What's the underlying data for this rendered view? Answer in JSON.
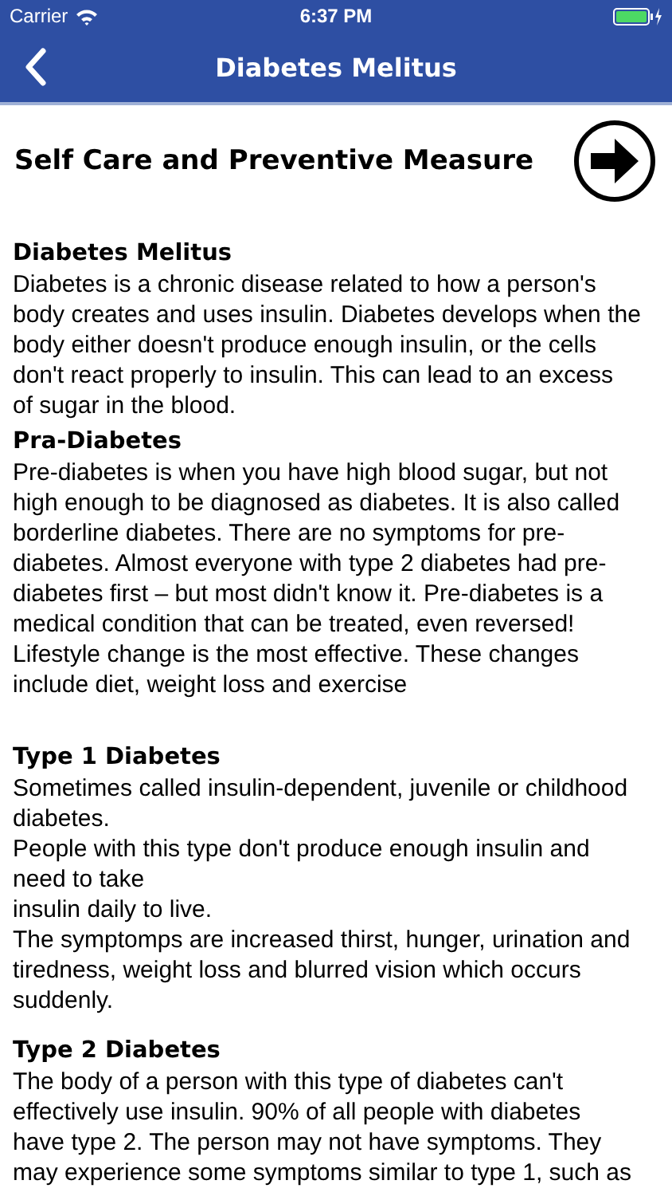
{
  "status_bar": {
    "carrier": "Carrier",
    "time": "6:37 PM"
  },
  "nav_bar": {
    "title": "Diabetes Melitus"
  },
  "header": {
    "title": "Self Care and Preventive Measure"
  },
  "sections": [
    {
      "heading": "Diabetes Melitus",
      "text": "Diabetes is a chronic disease related to how a person's\nbody creates and uses insulin. Diabetes develops when the\nbody either doesn't produce enough insulin, or the cells\ndon't react properly to insulin. This can lead to an excess\nof sugar in the blood."
    },
    {
      "heading": "Pra-Diabetes",
      "text": "Pre-diabetes is when you have high blood sugar, but not\nhigh enough to be diagnosed as diabetes. It is also called\nborderline diabetes. There are no symptoms for pre-\ndiabetes. Almost everyone with type 2 diabetes had pre-\ndiabetes first – but most didn't know it. Pre-diabetes is a\nmedical condition that can be treated, even reversed!\nLifestyle change is the most effective. These changes\ninclude diet, weight loss and exercise"
    },
    {
      "heading": "Type 1 Diabetes",
      "text": "Sometimes called insulin-dependent, juvenile or childhood\ndiabetes.\nPeople with this type don't produce enough insulin and\nneed to take\ninsulin daily to live.\nThe symptomps are increased thirst, hunger, urination and\ntiredness, weight loss and blurred vision which occurs\nsuddenly."
    },
    {
      "heading": "Type 2 Diabetes",
      "text": "The body of a person with this type of diabetes can't\neffectively use insulin. 90% of all people with diabetes\nhave type 2. The person may not have symptoms. They\nmay experience some symptoms similar to type 1, such as"
    }
  ]
}
